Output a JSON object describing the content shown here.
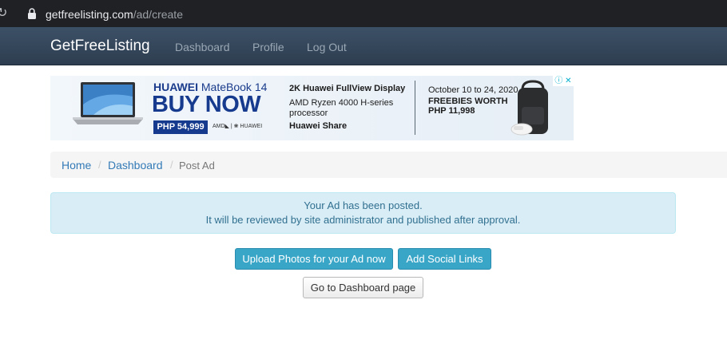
{
  "browser": {
    "domain": "getfreelisting.com",
    "path": "/ad/create",
    "reload_icon": "reload-icon",
    "lock_icon": "lock-icon"
  },
  "navbar": {
    "brand": "GetFreeListing",
    "links": [
      "Dashboard",
      "Profile",
      "Log Out"
    ]
  },
  "ad": {
    "title_brand": "HUAWEI",
    "title_model": "MateBook 14",
    "cta": "BUY NOW",
    "price": "PHP 54,999",
    "chips": "AMD◣ | ❀ HUAWEI",
    "specs": [
      "2K Huawei FullView Display",
      "AMD Ryzen 4000 H-series",
      "processor",
      "Huawei Share"
    ],
    "promo": [
      "October 10 to 24, 2020",
      "FREEBIES WORTH",
      "PHP 11,998"
    ],
    "adchoices": "ⓘ ✕"
  },
  "breadcrumb": {
    "items": [
      "Home",
      "Dashboard"
    ],
    "separator": "/",
    "active": "Post Ad"
  },
  "alert": {
    "line1": "Your Ad has been posted.",
    "line2": "It will be reviewed by site administrator and published after approval."
  },
  "actions": {
    "upload_photos": "Upload Photos for your Ad now",
    "add_social": "Add Social Links",
    "go_dashboard": "Go to Dashboard page"
  },
  "colors": {
    "navbar": "#2e3e50",
    "link": "#337ab7",
    "info_button": "#39a6c8",
    "alert_bg": "#d9edf7",
    "alert_text": "#31708f"
  }
}
